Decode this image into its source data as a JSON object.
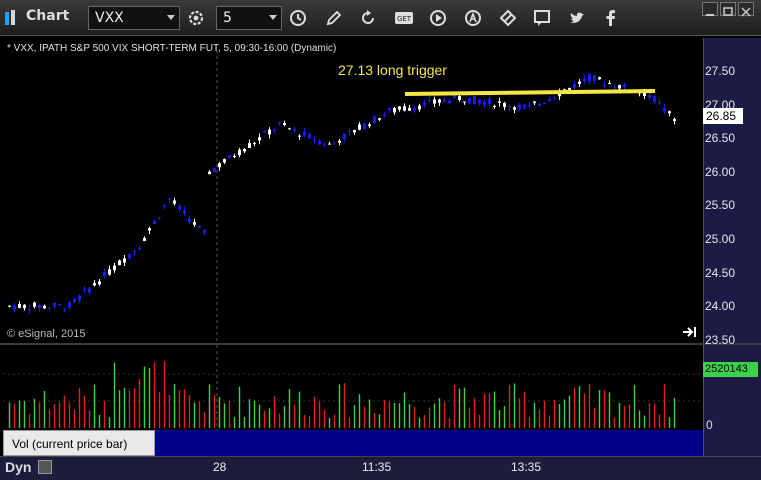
{
  "toolbar": {
    "title": "Chart",
    "symbol": "VXX",
    "interval": "5",
    "icons": [
      "settings-icon",
      "clock-icon",
      "pencil-icon",
      "refresh-icon",
      "get-icon",
      "play-icon",
      "alert-icon",
      "link-icon",
      "comment-icon",
      "twitter-icon",
      "facebook-icon"
    ],
    "get_label": "GET"
  },
  "chart": {
    "header": "* VXX, IPATH S&P 500 VIX SHORT-TERM FUT, 5, 09:30-16:00 (Dynamic)",
    "annotation": "27.13 long trigger",
    "copyright": "© eSignal, 2015",
    "last_price": "26.85",
    "volume_value": "2520143",
    "volume_zero": "0",
    "volume_label": "Vol (current price bar)",
    "close_label": "×",
    "bottom_label": "Dyn",
    "colors": {
      "up": "#ffffff",
      "down": "#1a1aff",
      "trigger_line": "#f5e642",
      "vol_up": "#3cd14b",
      "vol_down": "#e02020"
    }
  },
  "chart_data": {
    "type": "candlestick",
    "price_ticks": [
      "27.50",
      "27.00",
      "26.50",
      "26.00",
      "25.50",
      "25.00",
      "24.50",
      "24.00",
      "23.50"
    ],
    "time_labels": [
      "28",
      "11:35",
      "13:35"
    ],
    "trigger_level": 27.13,
    "ylim": [
      23.5,
      27.75
    ]
  }
}
